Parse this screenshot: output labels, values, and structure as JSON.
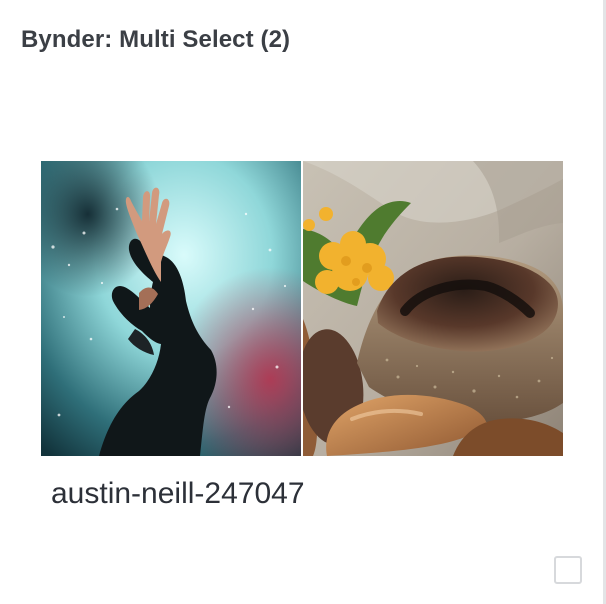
{
  "header": {
    "title": "Bynder: Multi Select (2)"
  },
  "assets": [
    {
      "name": "austin-neill-247047",
      "image": "concert-performer-photo"
    },
    {
      "name": "",
      "image": "bread-loaves-photo"
    }
  ],
  "selected_asset": {
    "label": "austin-neill-247047"
  },
  "colors": {
    "title": "#3b3f45",
    "asset_name": "#2c3038",
    "checkbox_border": "#d7d9dc",
    "panel_edge": "#e3e4e6"
  }
}
